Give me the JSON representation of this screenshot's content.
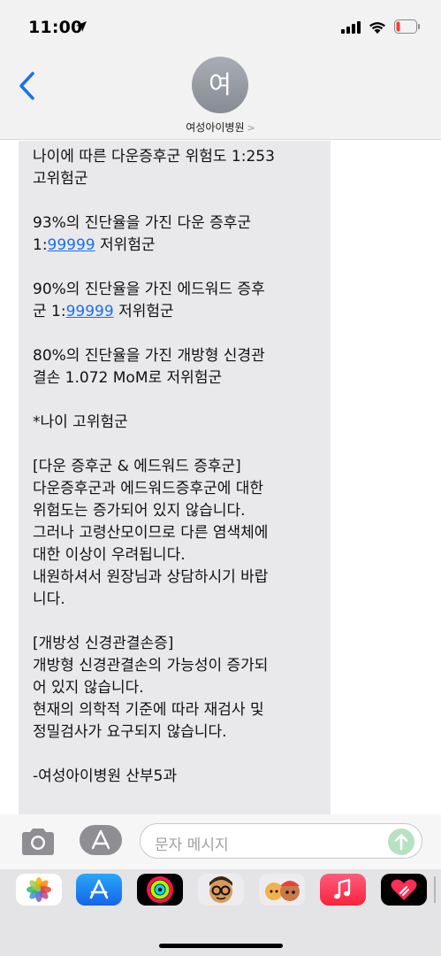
{
  "status_bar": {
    "time": "11:00"
  },
  "header": {
    "avatar_initial": "여",
    "contact_name": "여성아이병원",
    "contact_chevron": ">"
  },
  "message": {
    "lines": [
      [
        "나이에 따른 다운증후군 위험도 1:253",
        "고위험군"
      ],
      [
        "93%의 진단율을 가진 다운 증후군",
        {
          "pre": "1:",
          "link": "99999",
          "post": " 저위험군"
        }
      ],
      [
        "90%의 진단율을 가진 에드워드 증후",
        {
          "pre": "군 1:",
          "link": "99999",
          "post": " 저위험군"
        }
      ],
      [
        "80%의 진단율을 가진 개방형 신경관",
        "결손 1.072 MoM로 저위험군"
      ],
      [
        "*나이 고위험군"
      ],
      [
        "[다운 증후군 & 에드워드 증후군]",
        "다운증후군과 에드워드증후군에 대한",
        "위험도는 증가되어 있지 않습니다.",
        "그러나 고령산모이므로 다른 염색체에",
        "대한 이상이 우려됩니다.",
        "내원하셔서 원장님과 상담하시기 바랍",
        "니다."
      ],
      [
        "[개방성 신경관결손증]",
        "개방형 신경관결손의 가능성이 증가되",
        "어 있지 않습니다.",
        "현재의 의학적 기준에 따라 재검사 및",
        "정밀검사가 요구되지 않습니다."
      ],
      [
        "-여성아이병원 산부5과"
      ]
    ]
  },
  "input_bar": {
    "placeholder": "문자 메시지"
  },
  "app_drawer": {
    "apps": [
      "photos-icon",
      "app-store-icon",
      "activity-icon",
      "memoji-icon",
      "memoji-stickers-icon",
      "music-icon",
      "digital-touch-icon"
    ]
  },
  "colors": {
    "link": "#1a6ff0",
    "bubble": "#e9e9eb",
    "send": "#b6e2c2",
    "header": "#f2f2f2"
  }
}
